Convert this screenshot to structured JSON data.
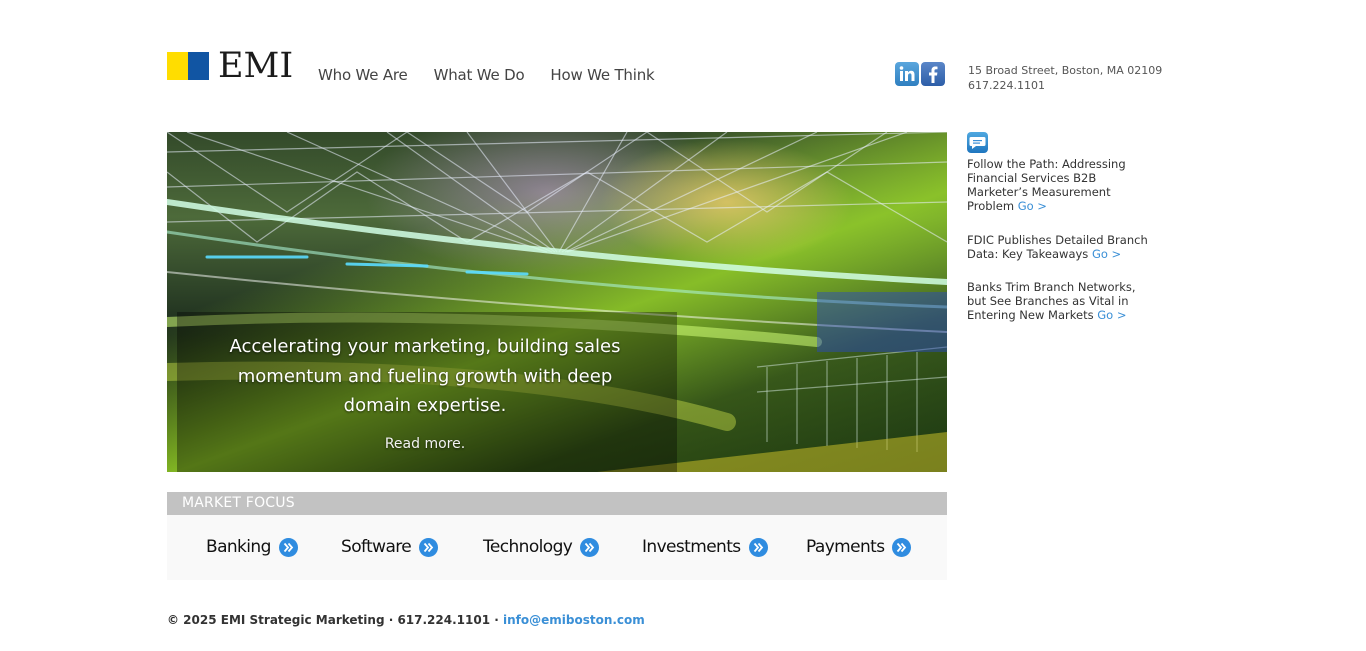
{
  "logo": {
    "text": "EMI",
    "colors": {
      "yellow": "#ffdd00",
      "blue": "#1155a3"
    }
  },
  "nav": {
    "items": [
      "Who We Are",
      "What We Do",
      "How We Think"
    ]
  },
  "social": {
    "icons": [
      "linkedin-icon",
      "facebook-icon"
    ]
  },
  "address": {
    "line1": "15 Broad Street, Boston, MA 02109",
    "line2": "617.224.1101"
  },
  "hero": {
    "headline": "Accelerating your marketing, building sales momentum and fueling growth with deep domain expertise.",
    "read_more": "Read more."
  },
  "news": {
    "icon": "chat-bubble-icon",
    "items": [
      {
        "title": "Follow the Path: Addressing Financial Services B2B Marketer’s Measurement Problem",
        "go": "Go >"
      },
      {
        "title": "FDIC Publishes Detailed Branch Data: Key Takeaways",
        "go": "Go >"
      },
      {
        "title": "Banks Trim Branch Networks, but See Branches as Vital in Entering New Markets",
        "go": "Go >"
      }
    ]
  },
  "market_focus": {
    "heading": "MARKET FOCUS",
    "items": [
      "Banking",
      "Software",
      "Technology",
      "Investments",
      "Payments"
    ]
  },
  "footer": {
    "text": "© 2025 EMI Strategic Marketing · 617.224.1101 · ",
    "email": "info@emiboston.com"
  },
  "colors": {
    "accent": "#3a8fd6",
    "arrow": "#2f8ce0",
    "bar": "#c2c2c2"
  }
}
